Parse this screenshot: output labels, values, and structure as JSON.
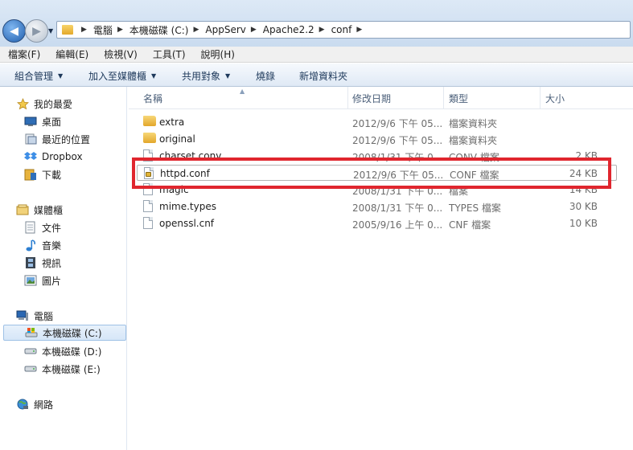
{
  "address": {
    "crumbs": [
      "電腦",
      "本機磁碟 (C:)",
      "AppServ",
      "Apache2.2",
      "conf"
    ]
  },
  "menu": [
    "檔案(F)",
    "編輯(E)",
    "檢視(V)",
    "工具(T)",
    "說明(H)"
  ],
  "commands": [
    {
      "label": "組合管理",
      "dropdown": true
    },
    {
      "label": "加入至媒體櫃",
      "dropdown": true
    },
    {
      "label": "共用對象",
      "dropdown": true
    },
    {
      "label": "燒錄",
      "dropdown": false
    },
    {
      "label": "新增資料夾",
      "dropdown": false
    }
  ],
  "nav": {
    "favorites": "我的最愛",
    "desktop": "桌面",
    "recent": "最近的位置",
    "dropbox": "Dropbox",
    "downloads": "下載",
    "libraries": "媒體櫃",
    "documents": "文件",
    "music": "音樂",
    "videos": "視訊",
    "pictures": "圖片",
    "computer": "電腦",
    "drive_c": "本機磁碟 (C:)",
    "drive_d": "本機磁碟 (D:)",
    "drive_e": "本機磁碟 (E:)",
    "network": "網路"
  },
  "columns": {
    "name": "名稱",
    "date": "修改日期",
    "type": "類型",
    "size": "大小"
  },
  "files": [
    {
      "name": "extra",
      "date": "2012/9/6 下午 05...",
      "type": "檔案資料夾",
      "size": "",
      "icon": "folder"
    },
    {
      "name": "original",
      "date": "2012/9/6 下午 05...",
      "type": "檔案資料夾",
      "size": "",
      "icon": "folder"
    },
    {
      "name": "charset.conv",
      "date": "2008/1/31 下午 0...",
      "type": "CONV 檔案",
      "size": "2 KB",
      "icon": "document"
    },
    {
      "name": "httpd.conf",
      "date": "2012/9/6 下午 05...",
      "type": "CONF 檔案",
      "size": "24 KB",
      "icon": "locked-document"
    },
    {
      "name": "magic",
      "date": "2008/1/31 下午 0...",
      "type": "檔案",
      "size": "14 KB",
      "icon": "document"
    },
    {
      "name": "mime.types",
      "date": "2008/1/31 下午 0...",
      "type": "TYPES 檔案",
      "size": "30 KB",
      "icon": "document"
    },
    {
      "name": "openssl.cnf",
      "date": "2005/9/16 上午 0...",
      "type": "CNF 檔案",
      "size": "10 KB",
      "icon": "document"
    }
  ],
  "colors": {
    "highlight": "#e0262e",
    "toolbar_text": "#1e395b"
  }
}
